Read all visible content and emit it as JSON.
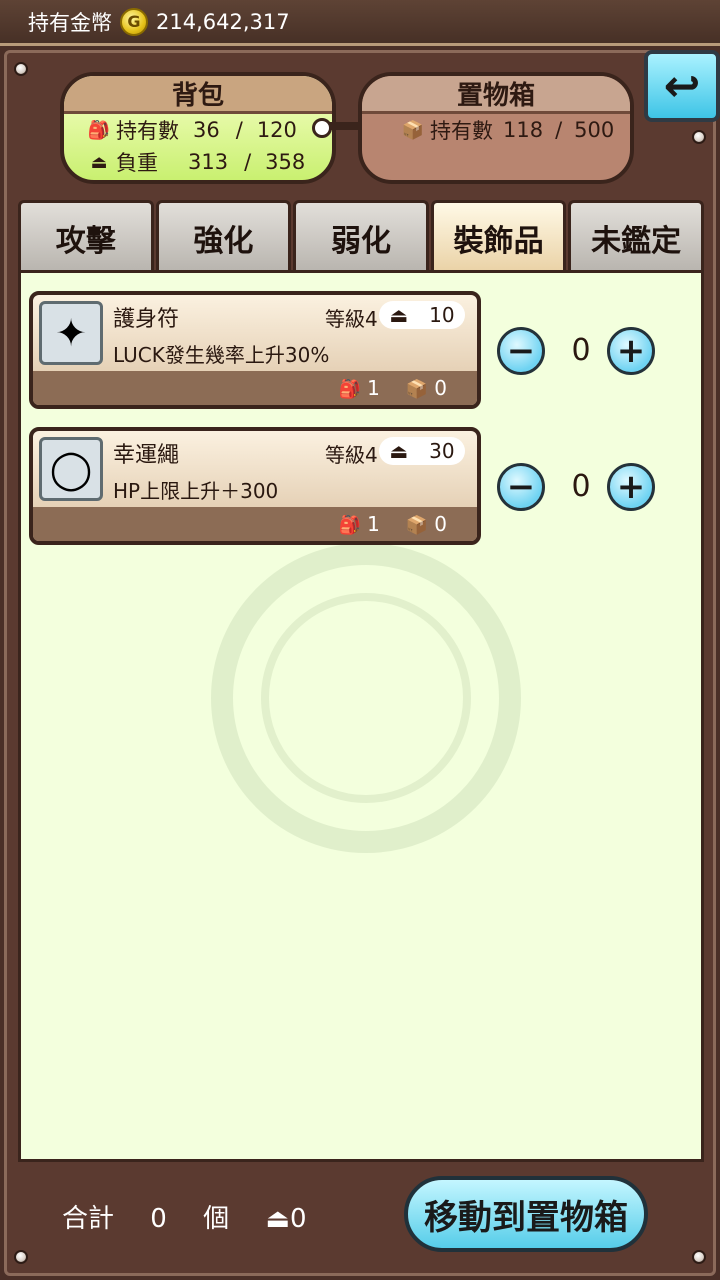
{
  "header": {
    "money_label": "持有金幣",
    "coin_symbol": "G",
    "money_value": "214,642,317"
  },
  "bag": {
    "title": "背包",
    "count_label": "持有數",
    "count_value": "36",
    "count_sep": "/",
    "count_max": "120",
    "weight_label": "負重",
    "weight_value": "313",
    "weight_sep": "/",
    "weight_max": "358"
  },
  "storage": {
    "title": "置物箱",
    "count_label": "持有數",
    "count_value": "118",
    "count_sep": "/",
    "count_max": "500"
  },
  "tabs": [
    {
      "label": "攻擊"
    },
    {
      "label": "強化"
    },
    {
      "label": "弱化"
    },
    {
      "label": "裝飾品"
    },
    {
      "label": "未鑑定"
    }
  ],
  "items": [
    {
      "name": "護身符",
      "level": "等級4",
      "weight": "10",
      "desc": "LUCK發生幾率上升30%",
      "bag_count": "1",
      "box_count": "0",
      "qty": "0",
      "icon": "amulet-icon"
    },
    {
      "name": "幸運繩",
      "level": "等級4",
      "weight": "30",
      "desc": "HP上限上升＋300",
      "bag_count": "1",
      "box_count": "0",
      "qty": "0",
      "icon": "lucky-rope-icon"
    }
  ],
  "footer": {
    "total_label": "合計",
    "total_value": "0",
    "unit": "個",
    "weight_value": "0",
    "move_button": "移動到置物箱"
  }
}
